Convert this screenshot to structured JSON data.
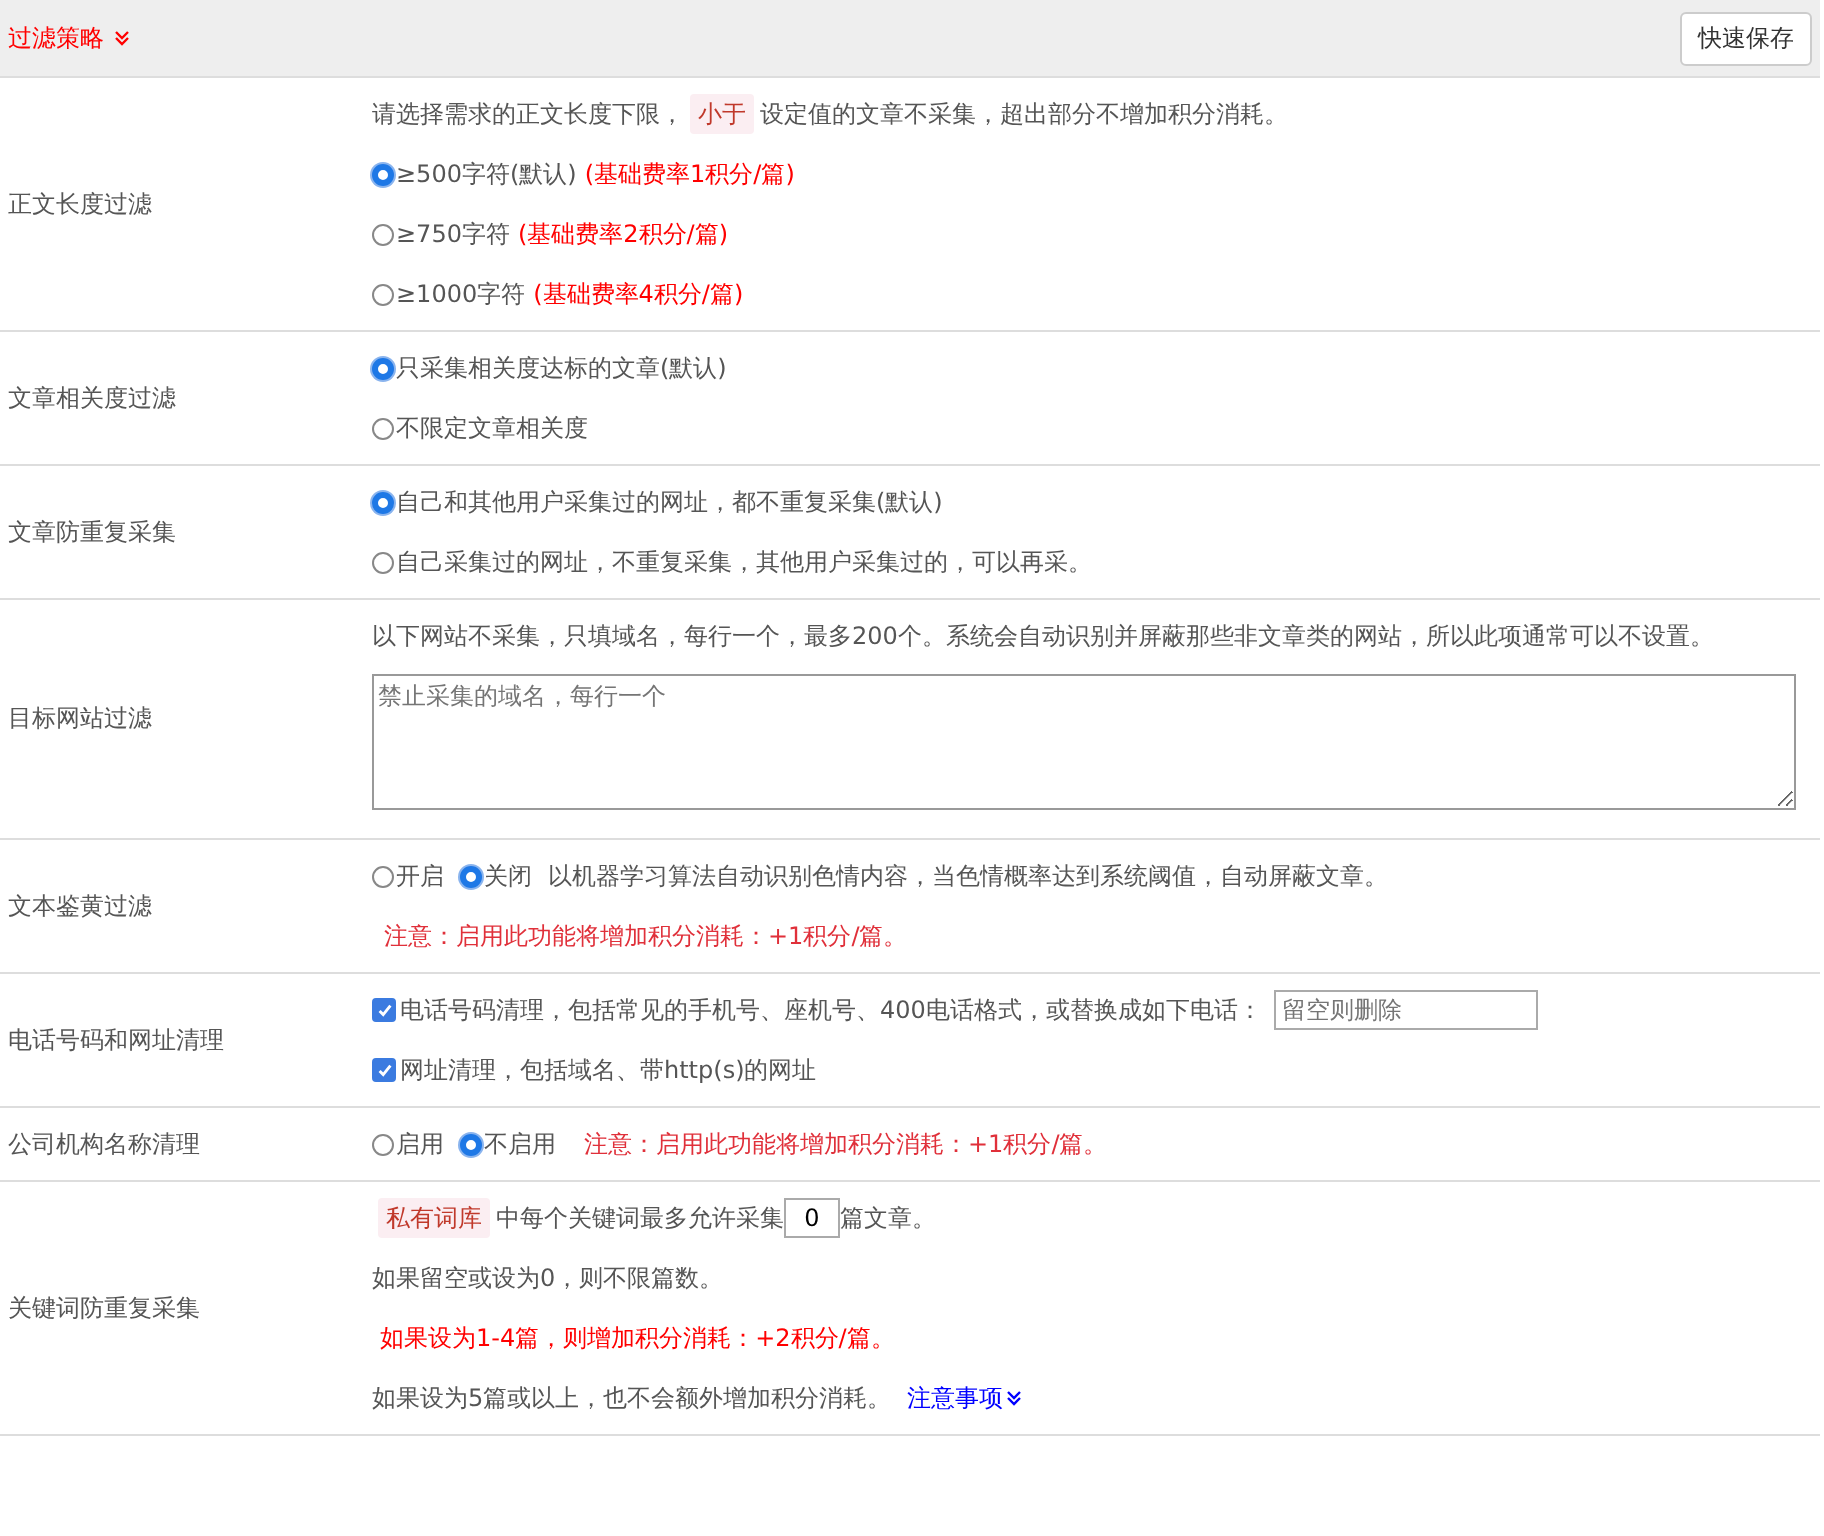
{
  "header": {
    "title": "过滤策略",
    "save_button": "快速保存"
  },
  "sections": [
    {
      "kind": "radio",
      "label": "正文长度过滤",
      "intro": [
        {
          "text": "请选择需求的正文长度下限，"
        },
        {
          "text": "小于",
          "kind": "tag"
        },
        {
          "text": "设定值的文章不采集，超出部分不增加积分消耗。"
        }
      ],
      "options": [
        {
          "text": "≥500字符(默认)",
          "note": "(基础费率1积分/篇)",
          "selected": true
        },
        {
          "text": "≥750字符",
          "note": "(基础费率2积分/篇)",
          "selected": false
        },
        {
          "text": "≥1000字符",
          "note": "(基础费率4积分/篇)",
          "selected": false
        }
      ]
    },
    {
      "kind": "radio",
      "label": "文章相关度过滤",
      "options": [
        {
          "text": "只采集相关度达标的文章(默认)",
          "selected": true
        },
        {
          "text": "不限定文章相关度",
          "selected": false
        }
      ]
    },
    {
      "kind": "radio",
      "label": "文章防重复采集",
      "options": [
        {
          "text": "自己和其他用户采集过的网址，都不重复采集(默认)",
          "selected": true
        },
        {
          "text": "自己采集过的网址，不重复采集，其他用户采集过的，可以再采。",
          "selected": false
        }
      ]
    },
    {
      "kind": "textarea",
      "label": "目标网站过滤",
      "intro": [
        {
          "text": "以下网站不采集，只填域名，每行一个，最多200个。系统会自动识别并屏蔽那些非文章类的网站，所以此项通常可以不设置。"
        }
      ],
      "placeholder": "禁止采集的域名，每行一个"
    },
    {
      "kind": "toggle",
      "label": "文本鉴黄过滤",
      "options": [
        {
          "text": "开启",
          "selected": false
        },
        {
          "text": "关闭",
          "selected": true
        }
      ],
      "desc": "以机器学习算法自动识别色情内容，当色情概率达到系统阈值，自动屏蔽文章。",
      "footnote": "注意：启用此功能将增加积分消耗：+1积分/篇。"
    },
    {
      "kind": "checkbox",
      "label": "电话号码和网址清理",
      "items": [
        {
          "text": "电话号码清理，包括常见的手机号、座机号、400电话格式，或替换成如下电话：",
          "checked": true,
          "placeholder": "留空则删除"
        },
        {
          "text": "网址清理，包括域名、带http(s)的网址",
          "checked": true
        }
      ]
    },
    {
      "kind": "toggle",
      "label": "公司机构名称清理",
      "options": [
        {
          "text": "启用",
          "selected": false
        },
        {
          "text": "不启用",
          "selected": true
        }
      ],
      "note": "注意：启用此功能将增加积分消耗：+1积分/篇。"
    },
    {
      "kind": "keyword",
      "label": "关键词防重复采集",
      "tag": "私有词库",
      "before": "中每个关键词最多允许采集",
      "value": "0",
      "after": "篇文章。",
      "lines": [
        {
          "kind": "plain",
          "text": "如果留空或设为0，则不限篇数。"
        },
        {
          "kind": "warn",
          "text": "如果设为1-4篇，则增加积分消耗：+2积分/篇。"
        },
        {
          "kind": "plain",
          "text": "如果设为5篇或以上，也不会额外增加积分消耗。",
          "link": "注意事项"
        }
      ]
    }
  ]
}
